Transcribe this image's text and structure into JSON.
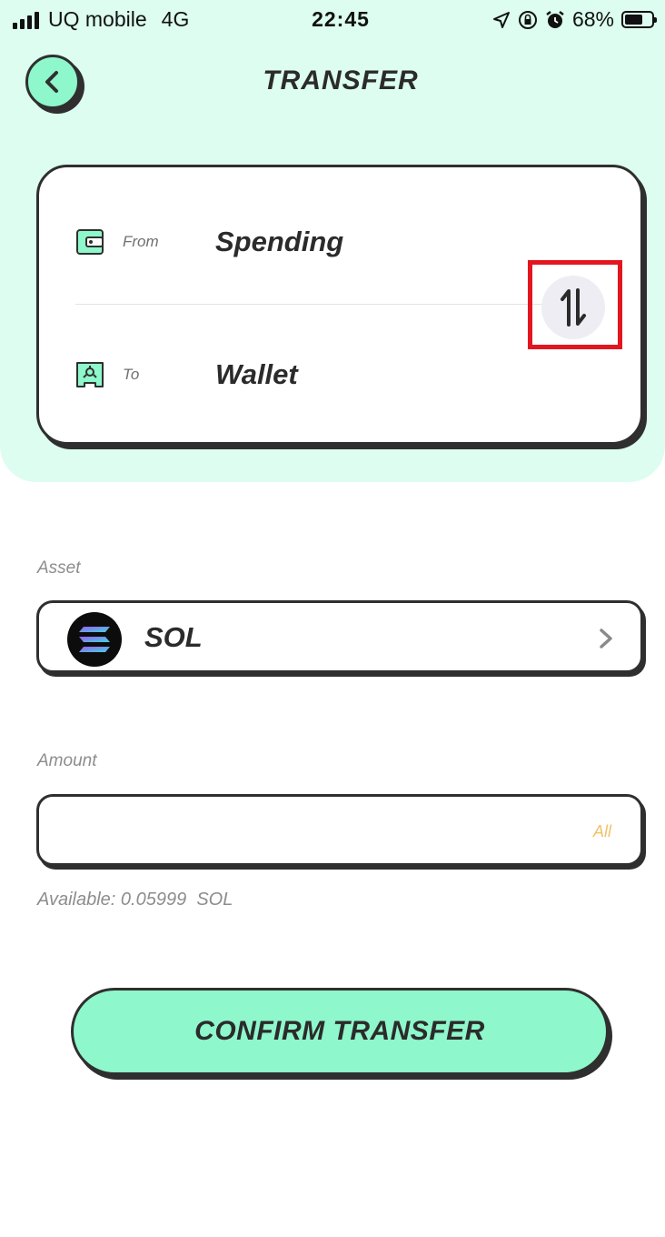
{
  "status_bar": {
    "carrier": "UQ mobile",
    "network": "4G",
    "time": "22:45",
    "battery": "68%",
    "battery_level": 0.68
  },
  "header": {
    "title": "TRANSFER",
    "back_icon": "chevron-left-icon"
  },
  "transfer": {
    "from_label": "From",
    "from_value": "Spending",
    "from_icon": "wallet-icon",
    "to_label": "To",
    "to_value": "Wallet",
    "to_icon": "wallet-account-icon",
    "swap_icon": "swap-vertical-icon"
  },
  "asset": {
    "label": "Asset",
    "value": "SOL",
    "icon": "solana-logo"
  },
  "amount": {
    "label": "Amount",
    "value": "",
    "all_label": "All",
    "available": "Available: 0.05999  SOL"
  },
  "confirm_label": "CONFIRM TRANSFER",
  "colors": {
    "mint_bg": "#dcfdef",
    "accent": "#8ef7cb",
    "outline": "#2f2f2f",
    "all_text": "#f0c36a",
    "highlight": "#e3161f"
  }
}
